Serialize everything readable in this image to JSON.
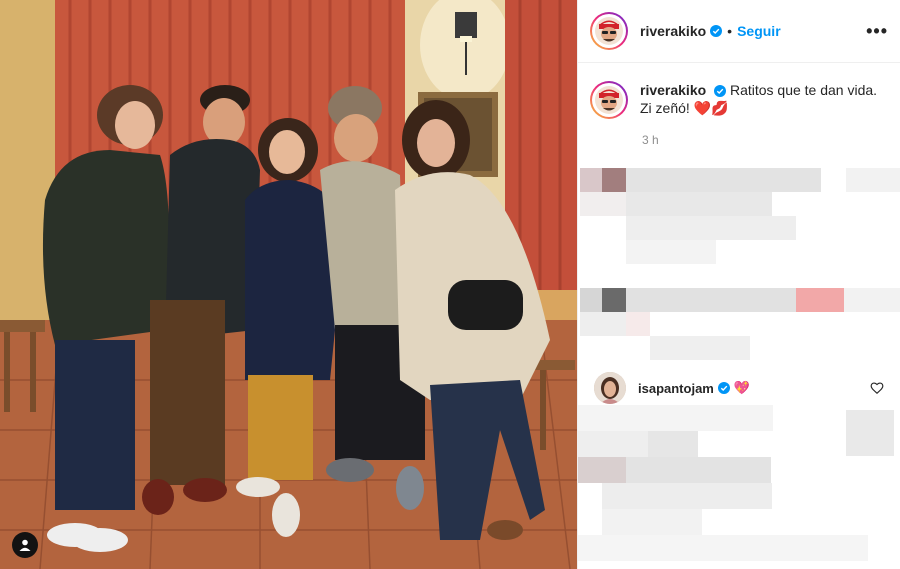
{
  "post": {
    "username": "riverakiko",
    "separator": "•",
    "follow_label": "Seguir",
    "more_label": "•••",
    "caption_line1": "Ratitos que te dan vida.",
    "caption_line2": "Zi zeñó! ❤️💋",
    "time": "3 h"
  },
  "comments": [
    {
      "username": "isapantojam",
      "emoji": "💖"
    }
  ],
  "icons": {
    "verified": "verified-badge-icon",
    "heart": "heart-outline-icon",
    "user_tag": "user-tag-icon",
    "more": "more-options-icon"
  },
  "colors": {
    "accent": "#0095f6",
    "verified": "#0095f6",
    "muted": "#8e8e8e",
    "divider": "#efefef"
  }
}
